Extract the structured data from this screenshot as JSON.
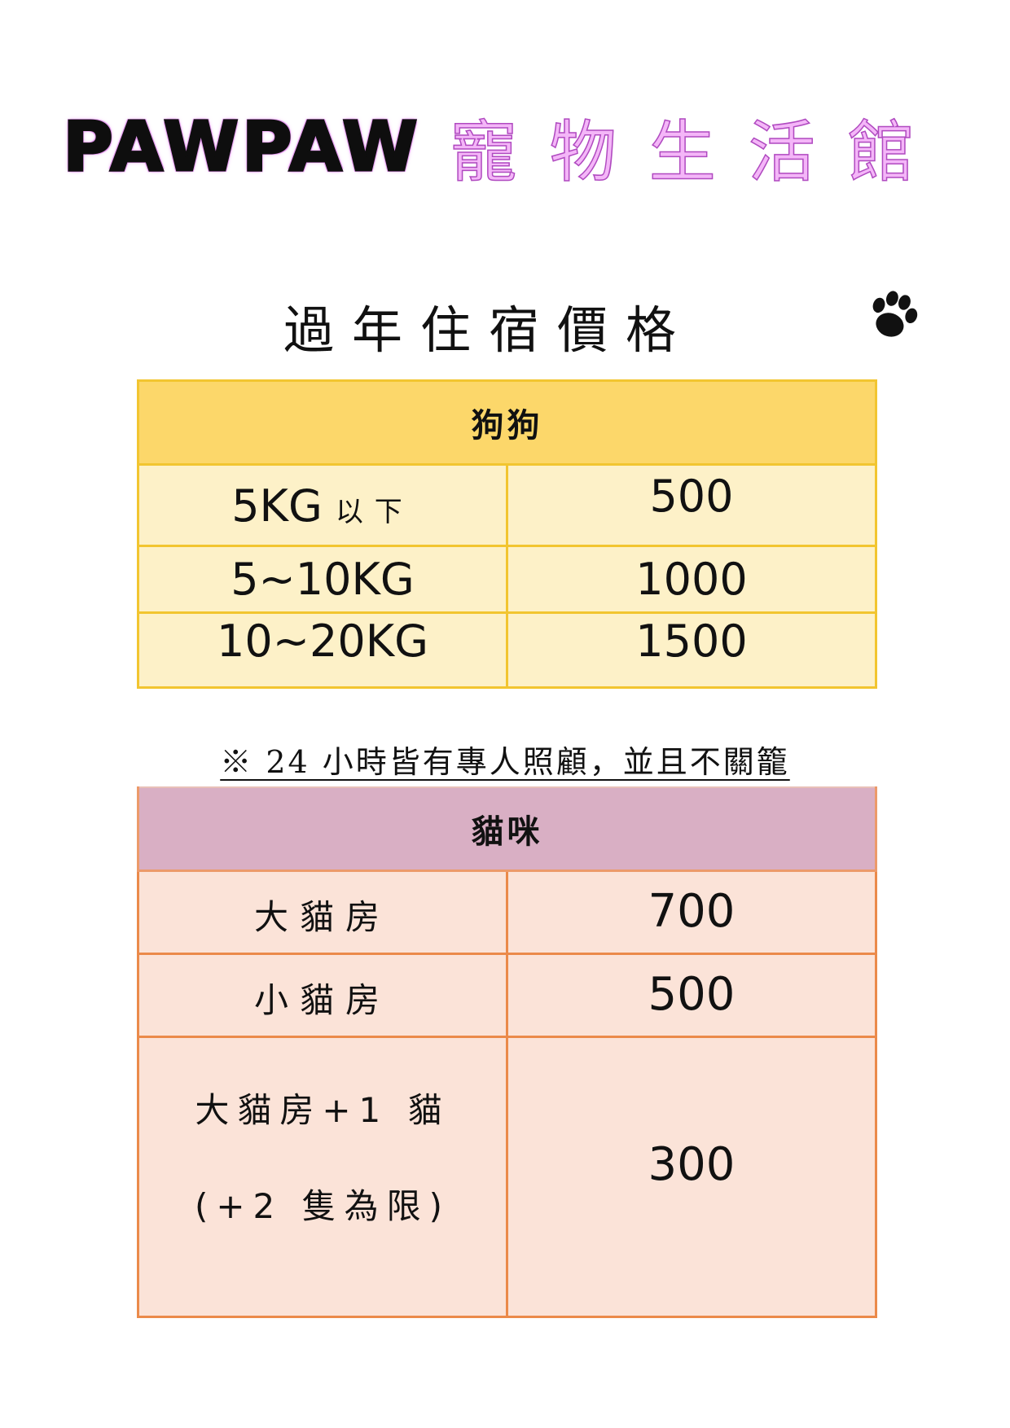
{
  "header": {
    "brand_latin": "PAWPAW",
    "brand_cjk": "寵物生活館"
  },
  "subtitle": "過年住宿價格",
  "icons": {
    "paw": "paw-print-icon"
  },
  "dog_table": {
    "title": "狗狗",
    "rows": [
      {
        "label_main": "5KG",
        "label_suffix": "以下",
        "price": "500"
      },
      {
        "label_main": "5~10KG",
        "label_suffix": "",
        "price": "1000"
      },
      {
        "label_main": "10~20KG",
        "label_suffix": "",
        "price": "1500"
      }
    ]
  },
  "note": "※ 24 小時皆有專人照顧，並且不關籠",
  "cat_table": {
    "title": "貓咪",
    "rows": [
      {
        "label": "大貓房",
        "price": "700"
      },
      {
        "label": "小貓房",
        "price": "500"
      },
      {
        "label_line1": "大貓房+1 貓",
        "label_line2": "(+2 隻為限)",
        "price": "300"
      }
    ]
  },
  "colors": {
    "dog_header": "#fcd76a",
    "dog_body": "#fdf1c8",
    "dog_border": "#f2c530",
    "cat_header": "#d9afc4",
    "cat_body": "#fbe3d8",
    "cat_border": "#eb8a4a",
    "brand_accent": "#e7a0f0"
  }
}
